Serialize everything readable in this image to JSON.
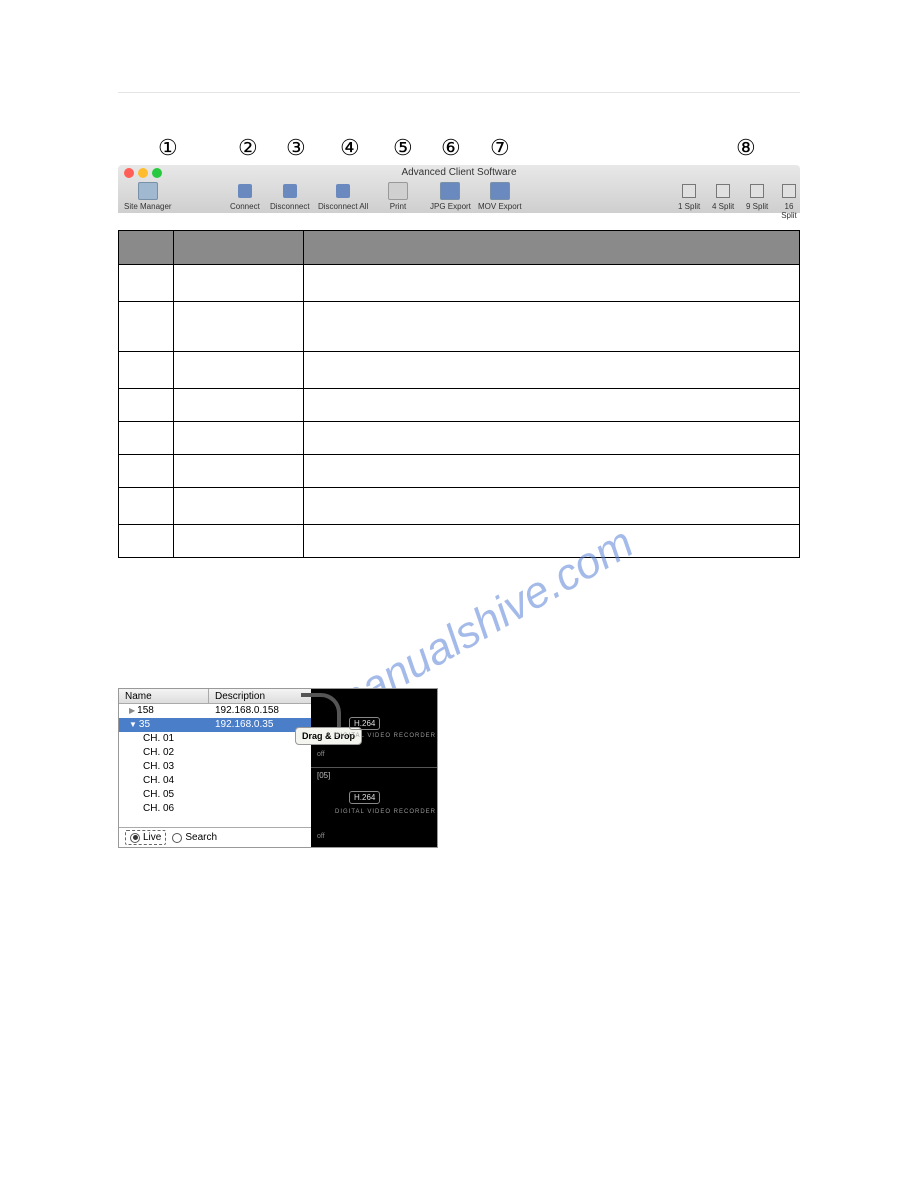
{
  "circled": [
    "①",
    "②",
    "③",
    "④",
    "⑤",
    "⑥",
    "⑦",
    "⑧"
  ],
  "toolbar": {
    "title": "Advanced Client Software",
    "site_manager": "Site Manager",
    "connect": "Connect",
    "disconnect": "Disconnect",
    "disconnect_all": "Disconnect All",
    "print": "Print",
    "jpg_export": "JPG Export",
    "mov_export": "MOV Export",
    "split1": "1 Split",
    "split4": "4 Split",
    "split9": "9 Split",
    "split16": "16 Split"
  },
  "sitelist": {
    "header_name": "Name",
    "header_desc": "Description",
    "rows": [
      {
        "name": "158",
        "desc": "192.168.0.158",
        "selected": false
      },
      {
        "name": "35",
        "desc": "192.168.0.35",
        "selected": true
      }
    ],
    "channels": [
      "CH. 01",
      "CH. 02",
      "CH. 03",
      "CH. 04",
      "CH. 05",
      "CH. 06"
    ],
    "radio_live": "Live",
    "radio_search": "Search",
    "drag_badge": "Drag & Drop",
    "codec": "H.264",
    "subtext": "DIGITAL VIDEO RECORDER",
    "off": "off",
    "ch05": "[05]"
  },
  "watermark": "manualshive.com"
}
